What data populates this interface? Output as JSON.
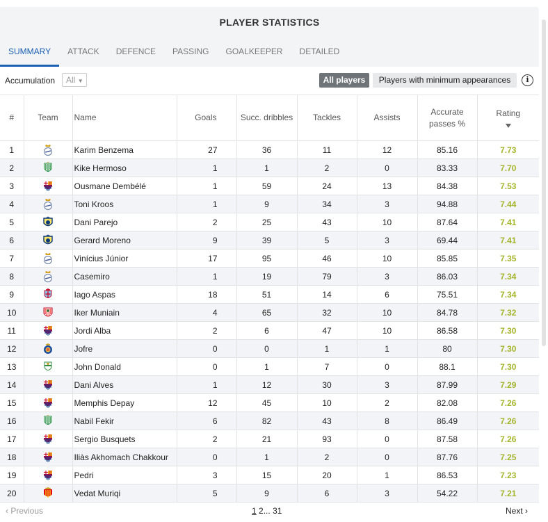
{
  "title": "PLAYER STATISTICS",
  "tabs": [
    {
      "label": "SUMMARY",
      "active": true
    },
    {
      "label": "ATTACK"
    },
    {
      "label": "DEFENCE"
    },
    {
      "label": "PASSING"
    },
    {
      "label": "GOALKEEPER"
    },
    {
      "label": "DETAILED"
    }
  ],
  "filters": {
    "accumulation_label": "Accumulation",
    "accumulation_value": "All",
    "all_players": "All players",
    "min_appearances": "Players with minimum appearances",
    "info": "i"
  },
  "table": {
    "headers": {
      "rank": "#",
      "team": "Team",
      "name": "Name",
      "goals": "Goals",
      "dribbles": "Succ. dribbles",
      "tackles": "Tackles",
      "assists": "Assists",
      "passes": "Accurate passes %",
      "rating": "Rating"
    },
    "rows": [
      {
        "rank": "1",
        "team": "real-madrid",
        "name": "Karim Benzema",
        "goals": "27",
        "dribbles": "36",
        "tackles": "11",
        "assists": "12",
        "passes": "85.16",
        "rating": "7.73"
      },
      {
        "rank": "2",
        "team": "real-betis",
        "name": "Kike Hermoso",
        "goals": "1",
        "dribbles": "1",
        "tackles": "2",
        "assists": "0",
        "passes": "83.33",
        "rating": "7.70"
      },
      {
        "rank": "3",
        "team": "barcelona",
        "name": "Ousmane Dembélé",
        "goals": "1",
        "dribbles": "59",
        "tackles": "24",
        "assists": "13",
        "passes": "84.38",
        "rating": "7.53"
      },
      {
        "rank": "4",
        "team": "real-madrid",
        "name": "Toni Kroos",
        "goals": "1",
        "dribbles": "9",
        "tackles": "34",
        "assists": "3",
        "passes": "94.88",
        "rating": "7.44"
      },
      {
        "rank": "5",
        "team": "villarreal",
        "name": "Dani Parejo",
        "goals": "2",
        "dribbles": "25",
        "tackles": "43",
        "assists": "10",
        "passes": "87.64",
        "rating": "7.41"
      },
      {
        "rank": "6",
        "team": "villarreal",
        "name": "Gerard Moreno",
        "goals": "9",
        "dribbles": "39",
        "tackles": "5",
        "assists": "3",
        "passes": "69.44",
        "rating": "7.41"
      },
      {
        "rank": "7",
        "team": "real-madrid",
        "name": "Vinícius Júnior",
        "goals": "17",
        "dribbles": "95",
        "tackles": "46",
        "assists": "10",
        "passes": "85.85",
        "rating": "7.35"
      },
      {
        "rank": "8",
        "team": "real-madrid",
        "name": "Casemiro",
        "goals": "1",
        "dribbles": "19",
        "tackles": "79",
        "assists": "3",
        "passes": "86.03",
        "rating": "7.34"
      },
      {
        "rank": "9",
        "team": "celta",
        "name": "Iago Aspas",
        "goals": "18",
        "dribbles": "51",
        "tackles": "14",
        "assists": "6",
        "passes": "75.51",
        "rating": "7.34"
      },
      {
        "rank": "10",
        "team": "athletic",
        "name": "Iker Muniain",
        "goals": "4",
        "dribbles": "65",
        "tackles": "32",
        "assists": "10",
        "passes": "84.78",
        "rating": "7.32"
      },
      {
        "rank": "11",
        "team": "barcelona",
        "name": "Jordi Alba",
        "goals": "2",
        "dribbles": "6",
        "tackles": "47",
        "assists": "10",
        "passes": "86.58",
        "rating": "7.30"
      },
      {
        "rank": "12",
        "team": "espanyol",
        "name": "Jofre",
        "goals": "0",
        "dribbles": "0",
        "tackles": "1",
        "assists": "1",
        "passes": "80",
        "rating": "7.30"
      },
      {
        "rank": "13",
        "team": "elche",
        "name": "John Donald",
        "goals": "0",
        "dribbles": "1",
        "tackles": "7",
        "assists": "0",
        "passes": "88.1",
        "rating": "7.30"
      },
      {
        "rank": "14",
        "team": "barcelona",
        "name": "Dani Alves",
        "goals": "1",
        "dribbles": "12",
        "tackles": "30",
        "assists": "3",
        "passes": "87.99",
        "rating": "7.29"
      },
      {
        "rank": "15",
        "team": "barcelona",
        "name": "Memphis Depay",
        "goals": "12",
        "dribbles": "45",
        "tackles": "10",
        "assists": "2",
        "passes": "82.08",
        "rating": "7.26"
      },
      {
        "rank": "16",
        "team": "real-betis",
        "name": "Nabil Fekir",
        "goals": "6",
        "dribbles": "82",
        "tackles": "43",
        "assists": "8",
        "passes": "86.49",
        "rating": "7.26"
      },
      {
        "rank": "17",
        "team": "barcelona",
        "name": "Sergio Busquets",
        "goals": "2",
        "dribbles": "21",
        "tackles": "93",
        "assists": "0",
        "passes": "87.58",
        "rating": "7.26"
      },
      {
        "rank": "18",
        "team": "barcelona",
        "name": "Iliàs Akhomach Chakkour",
        "goals": "0",
        "dribbles": "1",
        "tackles": "2",
        "assists": "0",
        "passes": "87.76",
        "rating": "7.25"
      },
      {
        "rank": "19",
        "team": "barcelona",
        "name": "Pedri",
        "goals": "3",
        "dribbles": "15",
        "tackles": "20",
        "assists": "1",
        "passes": "86.53",
        "rating": "7.23"
      },
      {
        "rank": "20",
        "team": "mallorca",
        "name": "Vedat Muriqi",
        "goals": "5",
        "dribbles": "9",
        "tackles": "6",
        "assists": "3",
        "passes": "54.22",
        "rating": "7.21"
      }
    ]
  },
  "pagination": {
    "previous": "‹ Previous",
    "page1": "1",
    "page2": "2",
    "ellipsis": "...",
    "last": "31",
    "next": "Next ›"
  },
  "colors": {
    "accent": "#1a5fb4",
    "rating": "#a5b52a",
    "stripe": "#f3f4f8"
  }
}
